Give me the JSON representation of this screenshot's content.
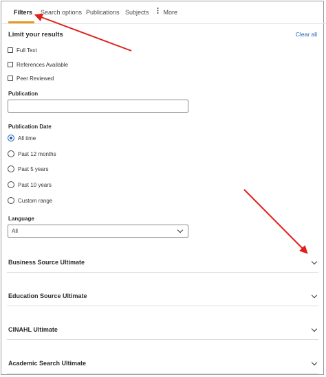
{
  "tabs": [
    {
      "label": "Filters",
      "active": true
    },
    {
      "label": "Search options",
      "active": false
    },
    {
      "label": "Publications",
      "active": false
    },
    {
      "label": "Subjects",
      "active": false
    },
    {
      "label": "More",
      "active": false,
      "icon": "more-vertical-icon"
    }
  ],
  "limit": {
    "title": "Limit your results",
    "clear_all": "Clear all",
    "checkboxes": [
      {
        "label": "Full Text",
        "checked": false
      },
      {
        "label": "References Available",
        "checked": false
      },
      {
        "label": "Peer Reviewed",
        "checked": false
      }
    ]
  },
  "publication": {
    "label": "Publication",
    "value": "",
    "placeholder": ""
  },
  "publication_date": {
    "label": "Publication Date",
    "options": [
      {
        "label": "All time",
        "selected": true
      },
      {
        "label": "Past 12 months",
        "selected": false
      },
      {
        "label": "Past 5 years",
        "selected": false
      },
      {
        "label": "Past 10 years",
        "selected": false
      },
      {
        "label": "Custom range",
        "selected": false
      }
    ]
  },
  "language": {
    "label": "Language",
    "value": "All"
  },
  "databases": [
    {
      "label": "Business Source Ultimate"
    },
    {
      "label": "Education Source Ultimate"
    },
    {
      "label": "CINAHL Ultimate"
    },
    {
      "label": "Academic Search Ultimate"
    }
  ],
  "colors": {
    "accent": "#e79a1e",
    "link": "#1a5fb4",
    "annotation": "#e0201a"
  }
}
